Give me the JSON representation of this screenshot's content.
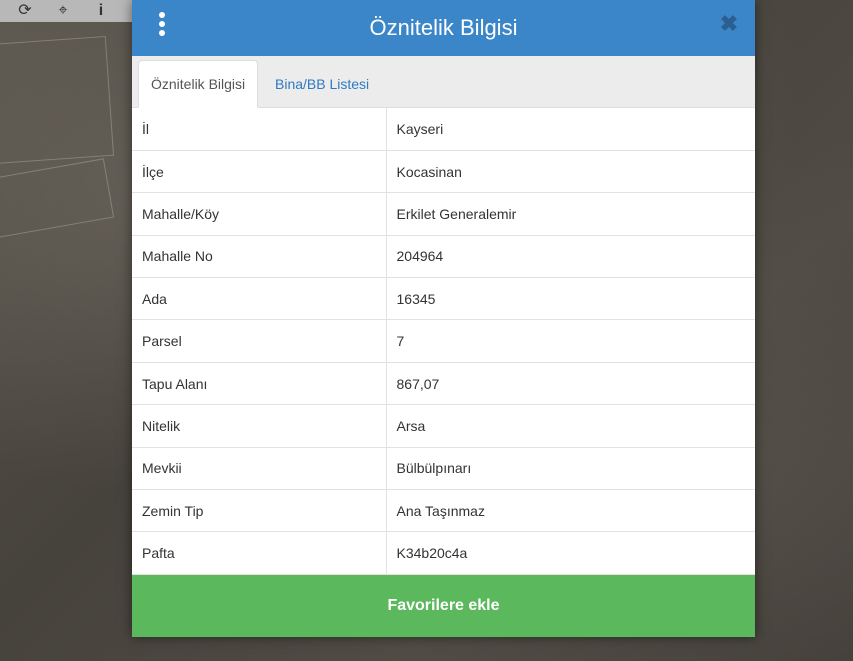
{
  "map": {
    "toolbar": [
      {
        "icon": "refresh-icon",
        "glyph": "⟳"
      },
      {
        "icon": "crosshair-icon",
        "glyph": "⌖"
      },
      {
        "icon": "info-icon",
        "glyph": "i"
      }
    ]
  },
  "dialog": {
    "title": "Öznitelik Bilgisi",
    "close_glyph": "✖",
    "tabs": [
      {
        "label": "Öznitelik Bilgisi",
        "active": true
      },
      {
        "label": "Bina/BB Listesi",
        "active": false
      }
    ],
    "rows": [
      {
        "key": "İl",
        "value": "Kayseri"
      },
      {
        "key": "İlçe",
        "value": "Kocasinan"
      },
      {
        "key": "Mahalle/Köy",
        "value": "Erkilet Generalemir"
      },
      {
        "key": "Mahalle No",
        "value": "204964"
      },
      {
        "key": "Ada",
        "value": "16345"
      },
      {
        "key": "Parsel",
        "value": "7"
      },
      {
        "key": "Tapu Alanı",
        "value": "867,07"
      },
      {
        "key": "Nitelik",
        "value": "Arsa"
      },
      {
        "key": "Mevkii",
        "value": "Bülbülpınarı"
      },
      {
        "key": "Zemin Tip",
        "value": "Ana Taşınmaz"
      },
      {
        "key": "Pafta",
        "value": "K34b20c4a"
      }
    ],
    "favorite_button": "Favorilere ekle"
  },
  "colors": {
    "header": "#3a86c8",
    "favorite": "#5cb85c",
    "tab_link": "#2f7ac0"
  }
}
